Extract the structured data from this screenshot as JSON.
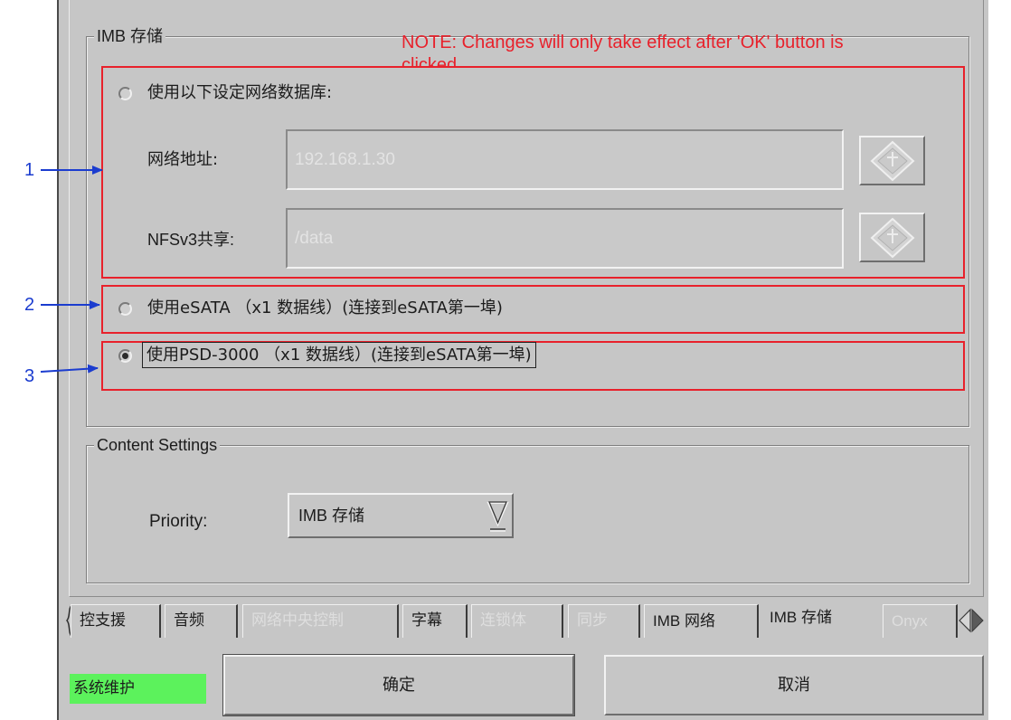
{
  "annotations": [
    "1",
    "2",
    "3"
  ],
  "storage_group": {
    "title": "IMB 存储",
    "note_line1": "NOTE: Changes will only take effect after 'OK' button is",
    "note_line2": "clicked",
    "network_db": {
      "radio_label": "使用以下设定网络数据库:",
      "selected": false,
      "address_label": "网络地址:",
      "address_value": "192.168.1.30",
      "share_label": "NFSv3共享:",
      "share_value": "/data",
      "browse_icon": "diamond-icon"
    },
    "esata": {
      "radio_label": "使用eSATA （x1 数据线）(连接到eSATA第一埠)",
      "selected": false
    },
    "psd": {
      "radio_label": "使用PSD-3000 （x1 数据线）(连接到eSATA第一埠)",
      "selected": true
    }
  },
  "content_group": {
    "title": "Content Settings",
    "priority_label": "Priority:",
    "priority_value": "IMB 存储",
    "dropdown_icon": "triangle-down-icon"
  },
  "tabs": [
    {
      "label": "控支援",
      "enabled": true
    },
    {
      "label": "音频",
      "enabled": true
    },
    {
      "label": "网络中央控制",
      "enabled": false
    },
    {
      "label": "字幕",
      "enabled": true
    },
    {
      "label": "连锁体",
      "enabled": false
    },
    {
      "label": "同步",
      "enabled": false
    },
    {
      "label": "IMB 网络",
      "enabled": true
    },
    {
      "label": "IMB 存储",
      "enabled": true
    },
    {
      "label": "Onyx",
      "enabled": false
    }
  ],
  "active_tab_index": 7,
  "tab_scroll_icons": [
    "chevron-left-icon",
    "chevron-right-icon"
  ],
  "status": {
    "label": "系统维护"
  },
  "buttons": {
    "ok": "确定",
    "cancel": "取消"
  },
  "colors": {
    "panel_grey": "#c6c6c6",
    "note_red": "#e8212b",
    "annotation_blue": "#1b3ccf",
    "status_green": "#5cf25c"
  }
}
